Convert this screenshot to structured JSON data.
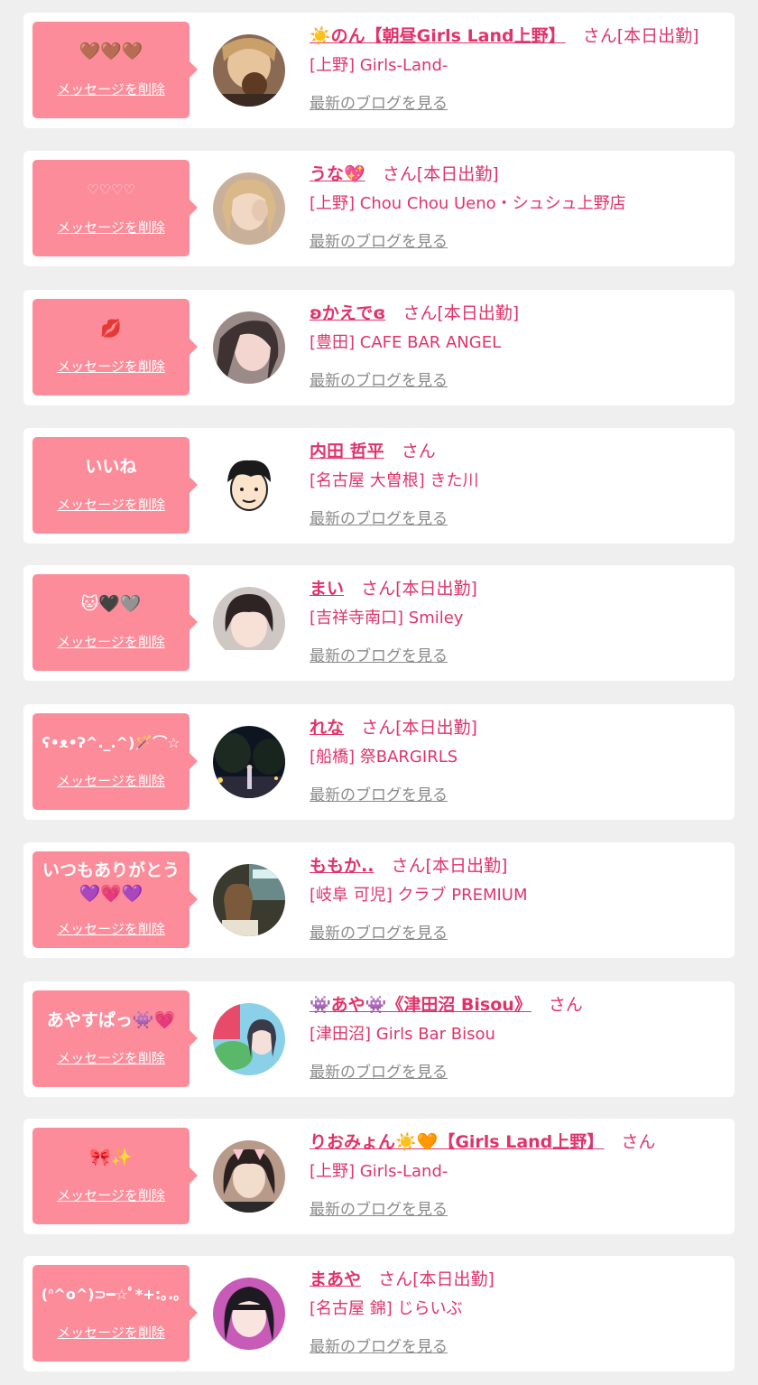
{
  "delete_label": "メッセージを削除",
  "san_label": "さん",
  "blog_label": "最新のブログを見る",
  "colors": {
    "accent": "#e0336a",
    "bubble": "#fd8c9a",
    "muted": "#8a8a8a",
    "background": "#efefef"
  },
  "messages": [
    {
      "message": "🤎🤎🤎",
      "name": "☀️のん【朝昼Girls Land上野】",
      "status": "[本日出勤]",
      "shop": "[上野] Girls-Land-"
    },
    {
      "message": "♡♡♡♡",
      "name": "うな💖",
      "status": "[本日出勤]",
      "shop": "[上野] Chou Chou Ueno・シュシュ上野店"
    },
    {
      "message": "💋",
      "name": "ʚかえでɞ",
      "status": "[本日出勤]",
      "shop": "[豊田] CAFE BAR ANGEL"
    },
    {
      "message": "いいね",
      "name": "内田 哲平",
      "status": "",
      "shop": "[名古屋 大曽根] きた川"
    },
    {
      "message": "🐱🖤🩶",
      "name": "まい",
      "status": "[本日出勤]",
      "shop": "[吉祥寺南口] Smiley"
    },
    {
      "message": "ʕ•ᴥ•ʔ^._.^)🪄⌒☆",
      "name": "れな",
      "status": "[本日出勤]",
      "shop": "[船橋] 祭BARGIRLS"
    },
    {
      "message": "いつもありがとう\n💜💗💜",
      "name": "ももか..",
      "status": "[本日出勤]",
      "shop": "[岐阜 可児] クラブ PREMIUM"
    },
    {
      "message": "あやすぱっ👾💗",
      "name": "👾あや👾《津田沼 Bisou》",
      "status": "",
      "shop": "[津田沼] Girls Bar Bisou"
    },
    {
      "message": "🎀✨",
      "name": "りおみょん☀️🧡【Girls Land上野】",
      "status": "",
      "shop": "[上野] Girls-Land-"
    },
    {
      "message": "(ᐢ^o^)⊃━☆ﾟ*+:｡.｡",
      "name": "まあや",
      "status": "[本日出勤]",
      "shop": "[名古屋 錦] じらいぶ"
    }
  ]
}
